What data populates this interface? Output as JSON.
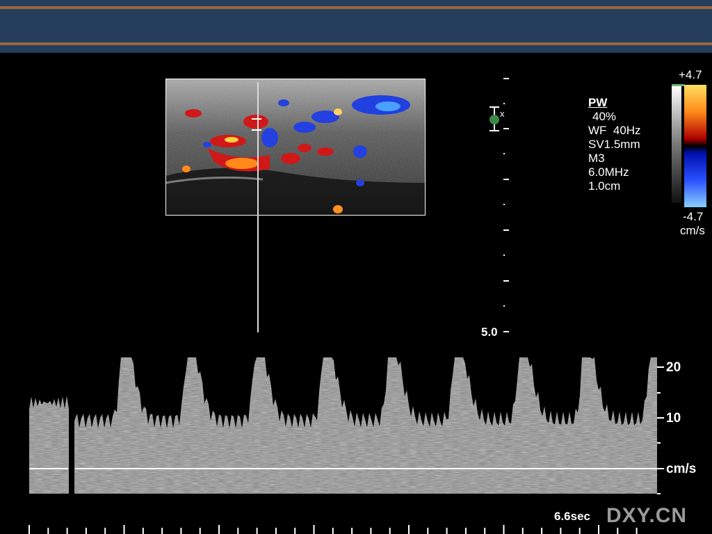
{
  "settings": {
    "mode": "PW",
    "gain": "40%",
    "wall_filter": "WF  40Hz",
    "sample_volume": "SV1.5mm",
    "map": "M3",
    "frequency": "6.0MHz",
    "gate_depth": "1.0cm"
  },
  "color_scale": {
    "top": "+4.7",
    "bottom": "-4.7",
    "unit": "cm/s"
  },
  "depth": {
    "max_label": "5.0"
  },
  "velocity_scale": {
    "labels": [
      "20",
      "10",
      "cm/s"
    ]
  },
  "sweep": {
    "duration": "6.6sec"
  },
  "watermark": "DXY.CN",
  "colors": {
    "header": "#243e5c",
    "header_stripe": "#9a6a3a",
    "doppler_red": "#d01818",
    "doppler_blue": "#2440e0"
  },
  "icons": [
    "focus-marker-icon",
    "sample-gate-icon"
  ]
}
